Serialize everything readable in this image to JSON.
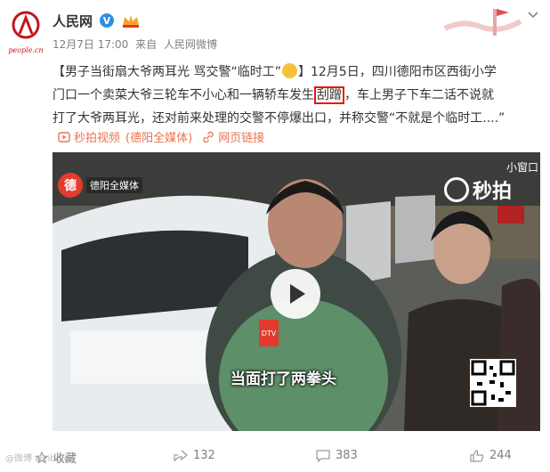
{
  "account": {
    "name": "人民网",
    "avatar_wordmark": "人民网",
    "avatar_latin": "people.cn",
    "verified_mark": "V",
    "member_icon": "member-crown-icon"
  },
  "meta": {
    "date": "12月7日 17:00",
    "source_prefix": "来自",
    "source_app": "人民网微博"
  },
  "content": {
    "line1_a": "【男子当街扇大爷两耳光 骂交警“临时工”",
    "line1_b": "】12月5日，四川德阳市区西街小学",
    "line2_a": "门口一个卖菜大爷三轮车不小心和一辆轿车发生",
    "line2_highlight": "刮蹭",
    "line2_b": "，车上男子下车二话不说就",
    "line3": "打了大爷两耳光，还对前来处理的交警不停爆出口，并称交警“不就是个临时工....”",
    "emoji": "sad-face-emoji"
  },
  "links": {
    "video_link": "秒拍视频",
    "sep": "|",
    "topic_link": "德阳全媒体",
    "web_link": "网页链接"
  },
  "video": {
    "channel_logo_text": "德阳全媒体",
    "channel_logo_initial": "德",
    "mini_window": "小窗口",
    "platform_logo": "秒拍",
    "subtitle": "当面打了两拳头",
    "play_icon": "play-icon",
    "mic_label": "DTV"
  },
  "actions": {
    "favorite": "收藏",
    "share_count": "132",
    "comment_count": "383",
    "like_count": "244"
  },
  "footer": {
    "watermark": "@微博 weibo.cn"
  },
  "colors": {
    "accent": "#eb7350",
    "verified": "#2d8fe2",
    "highlight_box": "#ee1111",
    "brand_red": "#c3161c"
  }
}
